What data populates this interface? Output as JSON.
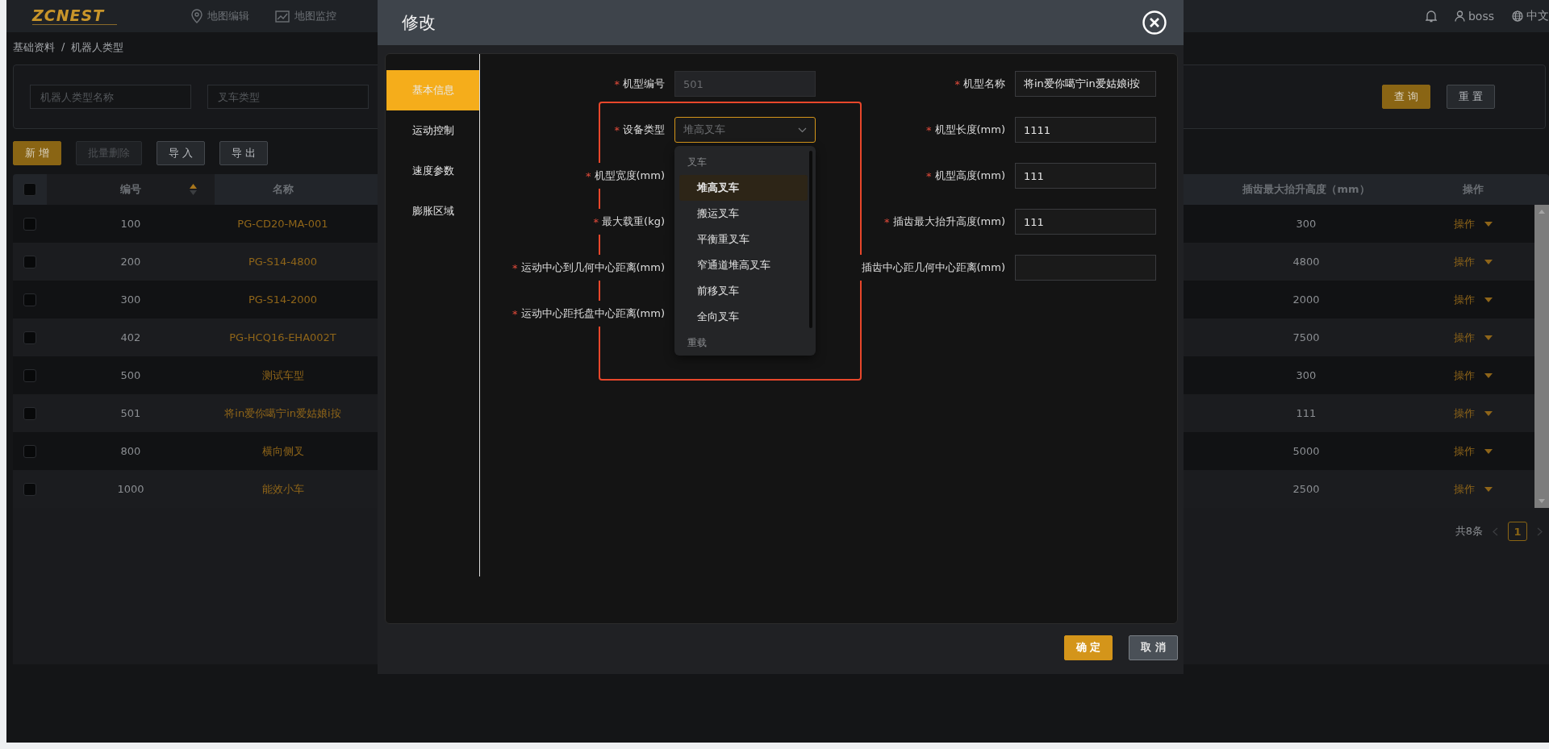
{
  "header": {
    "logo": "ZCNEST",
    "nav": [
      {
        "label": "地图编辑"
      },
      {
        "label": "地图监控"
      }
    ],
    "user": "boss",
    "language": "中文"
  },
  "breadcrumb": {
    "items": [
      "基础资料",
      "机器人类型"
    ],
    "separator": "/"
  },
  "filters": [
    {
      "placeholder": "机器人类型名称"
    },
    {
      "placeholder": "叉车类型"
    }
  ],
  "filter_buttons": [
    {
      "label": "查 询",
      "kind": "primary"
    },
    {
      "label": "重 置",
      "kind": "default"
    }
  ],
  "toolbar": [
    {
      "label": "新 增",
      "kind": "primary",
      "disabled": false
    },
    {
      "label": "批量删除",
      "kind": "default",
      "disabled": true
    },
    {
      "label": "导 入",
      "kind": "default",
      "disabled": false
    },
    {
      "label": "导 出",
      "kind": "default",
      "disabled": false
    }
  ],
  "table": {
    "all_checked": false,
    "columns": [
      {
        "label": "编号",
        "sortable": true
      },
      {
        "label": "名称",
        "sortable": false
      },
      {
        "label": "插齿最大抬升高度（mm）",
        "sortable": false
      },
      {
        "label": "操作",
        "sortable": false
      }
    ],
    "rows": [
      {
        "checked": false,
        "id": "100",
        "name": "PG-CD20-MA-001",
        "lift": "300",
        "action": "操作"
      },
      {
        "checked": false,
        "id": "200",
        "name": "PG-S14-4800",
        "lift": "4800",
        "action": "操作"
      },
      {
        "checked": false,
        "id": "300",
        "name": "PG-S14-2000",
        "lift": "2000",
        "action": "操作"
      },
      {
        "checked": false,
        "id": "402",
        "name": "PG-HCQ16-EHA002T",
        "lift": "7500",
        "action": "操作"
      },
      {
        "checked": false,
        "id": "500",
        "name": "测试车型",
        "lift": "300",
        "action": "操作"
      },
      {
        "checked": false,
        "id": "501",
        "name": "将in爱你噶宁in爱姑娘i按",
        "lift": "111",
        "action": "操作"
      },
      {
        "checked": false,
        "id": "800",
        "name": "横向侧叉",
        "lift": "5000",
        "action": "操作"
      },
      {
        "checked": false,
        "id": "1000",
        "name": "能效小车",
        "lift": "2500",
        "action": "操作"
      }
    ]
  },
  "pagination": {
    "total": "共8条",
    "pages": [
      {
        "label": "1",
        "selected": true
      }
    ]
  },
  "modal": {
    "title": "修改",
    "tabs": [
      {
        "label": "基本信息",
        "selected": true
      },
      {
        "label": "运动控制",
        "selected": false
      },
      {
        "label": "速度参数",
        "selected": false
      },
      {
        "label": "膨胀区域",
        "selected": false
      }
    ],
    "fields": [
      {
        "mark": "*",
        "label": "机型编号",
        "kind": "input",
        "value": "501",
        "disabled": true
      },
      {
        "mark": "*",
        "label": "机型名称",
        "kind": "input",
        "value": "将in爱你噶宁in爱姑娘i按",
        "disabled": false
      },
      {
        "mark": "*",
        "label": "设备类型",
        "kind": "select",
        "value": "堆高叉车",
        "open": true,
        "groups": [
          {
            "label": "叉车",
            "options": [
              {
                "label": "堆高叉车",
                "selected": true
              },
              {
                "label": "搬运叉车",
                "selected": false
              },
              {
                "label": "平衡重叉车",
                "selected": false
              },
              {
                "label": "窄通道堆高叉车",
                "selected": false
              },
              {
                "label": "前移叉车",
                "selected": false
              },
              {
                "label": "全向叉车",
                "selected": false
              }
            ]
          },
          {
            "label": "重载"
          }
        ]
      },
      {
        "mark": "*",
        "label": "机型长度(mm)",
        "kind": "input",
        "value": "1111",
        "disabled": false
      },
      {
        "mark": "*",
        "label": "机型宽度(mm)",
        "kind": "label"
      },
      {
        "mark": "*",
        "label": "机型高度(mm)",
        "kind": "input",
        "value": "111",
        "disabled": false
      },
      {
        "mark": "*",
        "label": "最大载重(kg)",
        "kind": "label"
      },
      {
        "mark": "*",
        "label": "插齿最大抬升高度(mm)",
        "kind": "input",
        "value": "111",
        "disabled": false
      },
      {
        "mark": "*",
        "label": "运动中心到几何中心距离(mm)",
        "kind": "label"
      },
      {
        "label": "插齿中心距几何中心距离(mm)",
        "kind": "input",
        "disabled": false
      },
      {
        "mark": "*",
        "label": "运动中心距托盘中心距离(mm)",
        "kind": "label"
      }
    ],
    "buttons": [
      {
        "label": "确 定",
        "kind": "primary"
      },
      {
        "label": "取 消",
        "kind": "default"
      }
    ]
  }
}
